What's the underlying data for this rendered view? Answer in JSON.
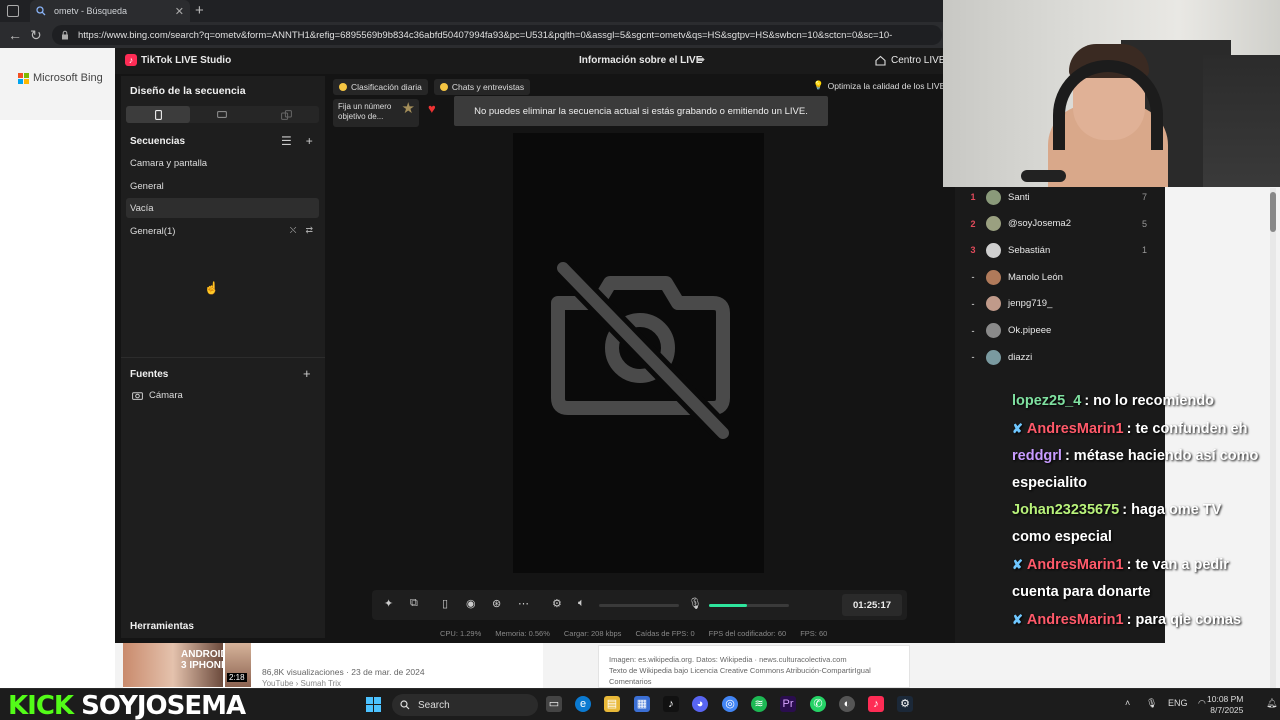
{
  "browser": {
    "tab_title": "ometv - Búsqueda",
    "url": "https://www.bing.com/search?q=ometv&form=ANNTH1&refig=6895569b9b834c36abfd50407994fa93&pc=U531&pqlth=0&assgl=5&sgcnt=ometv&qs=HS&sgtpv=HS&swbcn=10&sctcn=0&sc=10-"
  },
  "bing": {
    "logo_text": "Microsoft Bing",
    "video_meta": "86,8K visualizaciones · 23 de mar. de 2024",
    "video_source": "YouTube › Sumah Trix",
    "video_duration": "2:18",
    "thumb_text": "ANDROID 3 IPHONE",
    "source_line1": "Imagen: es.wikipedia.org. Datos: Wikipedia · news.culturacolectiva.com",
    "source_line2": "Texto de Wikipedia bajo Licencia Creative Commons Atribución-CompartirIgual",
    "source_line3": "Comentarios"
  },
  "studio": {
    "app_name": "TikTok LIVE Studio",
    "live_info": "Información sobre el LIVE",
    "centro": "Centro LIVE",
    "left": {
      "layout_title": "Diseño de la secuencia",
      "scenes_title": "Secuencias",
      "scenes": [
        "Camara y pantalla",
        "General",
        "Vacía",
        "General(1)"
      ],
      "sources_title": "Fuentes",
      "sources": [
        "Cámara"
      ],
      "tools_title": "Herramientas"
    },
    "center": {
      "chip_daily": "Clasificación diaria",
      "chip_chats": "Chats y entrevistas",
      "goal_text": "Fija un número objetivo de...",
      "toast": "No puedes eliminar la secuencia actual si estás grabando o emitiendo un LIVE.",
      "optimize": "Optimiza la calidad de los LIVE",
      "timer": "01:25:17",
      "mic_level": 0.48,
      "stats": [
        "CPU:  1.29%",
        "Memoria:  0.56%",
        "Cargar:  208 kbps",
        "Caídas de FPS:  0",
        "FPS del codificador:  60",
        "FPS:  60"
      ]
    }
  },
  "leaderboard": [
    {
      "rank": "1",
      "name": "Santi",
      "count": "7",
      "color": "#8a9a7a"
    },
    {
      "rank": "2",
      "name": "@soyJosema2",
      "count": "5",
      "color": "#9aa080"
    },
    {
      "rank": "3",
      "name": "Sebastián",
      "count": "1",
      "color": "#cfcfcf"
    },
    {
      "rank": "-",
      "name": "Manolo León",
      "count": "",
      "color": "#b07a5a"
    },
    {
      "rank": "-",
      "name": "jenpg719_",
      "count": "",
      "color": "#c09a8a"
    },
    {
      "rank": "-",
      "name": "Ok.pipeee",
      "count": "",
      "color": "#8a8a8a"
    },
    {
      "rank": "-",
      "name": "diazzi",
      "count": "",
      "color": "#7a9aa0"
    }
  ],
  "chat": [
    {
      "user": "lopez25_4",
      "text": ": no lo recomiendo",
      "color": "#7fe0a0",
      "badge": false
    },
    {
      "user": "AndresMarin1",
      "text": ": te confunden eh",
      "color": "#ff5a6a",
      "badge": true
    },
    {
      "user": "reddgrl",
      "text": ": métase haciendo así como",
      "color": "#c89cff",
      "badge": false
    },
    {
      "user": "",
      "text": "especialito",
      "color": "#ffffff",
      "badge": false
    },
    {
      "user": "Johan23235675",
      "text": ": haga ome TV",
      "color": "#b8f27a",
      "badge": false
    },
    {
      "user": "",
      "text": "como especial",
      "color": "#ffffff",
      "badge": false
    },
    {
      "user": "AndresMarin1",
      "text": ": te van a pedir",
      "color": "#ff5a6a",
      "badge": true
    },
    {
      "user": "",
      "text": "cuenta para donarte",
      "color": "#ffffff",
      "badge": false
    },
    {
      "user": "AndresMarin1",
      "text": ": para qie comas",
      "color": "#ff5a6a",
      "badge": true
    }
  ],
  "overlay": {
    "kick_text": "KICK",
    "channel": "SOYJOSEMA"
  },
  "taskbar": {
    "search": "Search",
    "lang": "ENG",
    "time": "10:08 PM",
    "date": "8/7/2025"
  }
}
